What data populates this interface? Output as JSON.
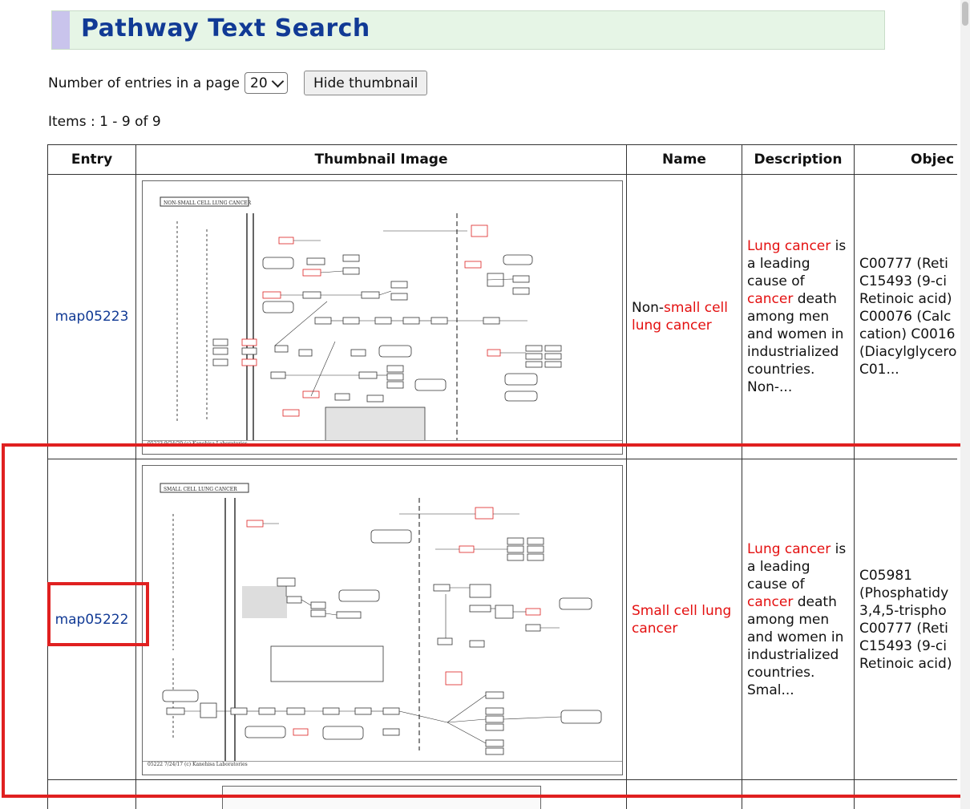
{
  "page": {
    "title": "Pathway Text Search"
  },
  "controls": {
    "entries_label": "Number of entries in a page",
    "entries_value": "20",
    "hide_thumbnail_label": "Hide thumbnail",
    "items_text": "Items : 1 - 9 of 9"
  },
  "table": {
    "headers": [
      "Entry",
      "Thumbnail Image",
      "Name",
      "Description",
      "Objec"
    ],
    "rows": [
      {
        "entry": "map05223",
        "name_pre": "Non-",
        "name_hl": "small cell lung cancer",
        "name_post": "",
        "desc": [
          "Lung cancer",
          " is a leading cause of ",
          "cancer",
          " death among men and women in industrialized countries. Non-..."
        ],
        "objects": "C00777 (Reti\nC15493 (9-ci\nRetinoic acid)\nC00076 (Calc\ncation) C0016\n(Diacylglycero\nC01...",
        "thumb_title": "NON-SMALL CELL LUNG CANCER",
        "thumb_footer": "05223 9/24/20 (c) Kanehisa Laboratories"
      },
      {
        "entry": "map05222",
        "name_pre": "",
        "name_hl": "Small cell lung cancer",
        "name_post": "",
        "desc": [
          "Lung cancer",
          " is a leading cause of ",
          "cancer",
          " death among men and women in industrialized countries. Smal..."
        ],
        "objects": "C05981\n(Phosphatidy\n3,4,5-trispho\nC00777 (Reti\nC15493 (9-ci\nRetinoic acid)",
        "thumb_title": "SMALL CELL LUNG CANCER",
        "thumb_footer": "05222 7/24/17 (c) Kanehisa Laboratories"
      }
    ]
  }
}
